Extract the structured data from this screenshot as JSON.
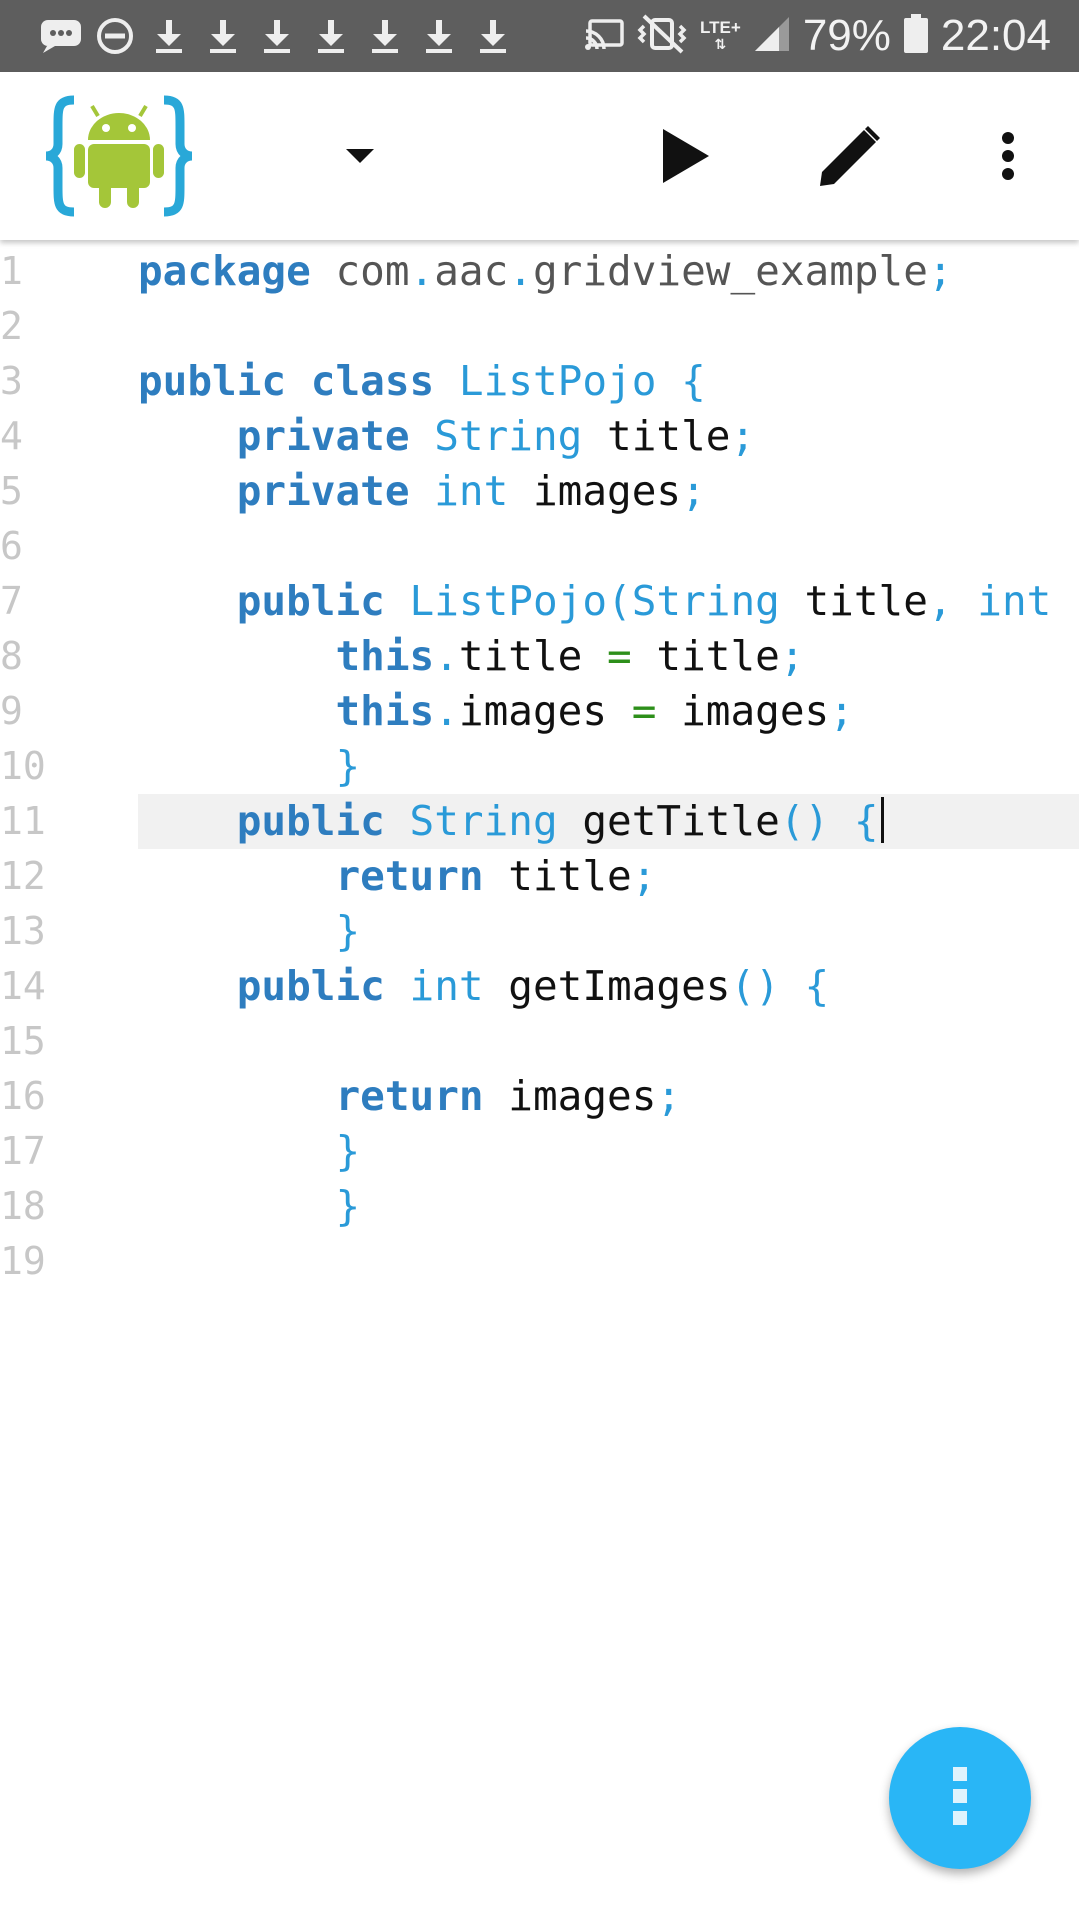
{
  "status_bar": {
    "left_icons": [
      "chat-bubble-icon",
      "do-not-disturb-icon",
      "download-icon",
      "download-icon",
      "download-icon",
      "download-icon",
      "download-icon",
      "download-icon",
      "download-icon"
    ],
    "network_label": "LTE+",
    "battery_percent": "79%",
    "time": "22:04"
  },
  "toolbar": {
    "app_icon": "android-braces-logo-icon",
    "dropdown_icon": "dropdown-arrow-icon",
    "run_icon": "play-icon",
    "edit_icon": "pencil-icon",
    "menu_icon": "more-vertical-icon"
  },
  "editor": {
    "current_line": 11,
    "lines": [
      {
        "n": "1",
        "tokens": [
          {
            "t": "package",
            "c": "kw"
          },
          {
            "t": " ",
            "c": "id"
          },
          {
            "t": "com",
            "c": "pk"
          },
          {
            "t": ".",
            "c": "pn"
          },
          {
            "t": "aac",
            "c": "pk"
          },
          {
            "t": ".",
            "c": "pn"
          },
          {
            "t": "gridview_example",
            "c": "pk"
          },
          {
            "t": ";",
            "c": "pn"
          }
        ]
      },
      {
        "n": "2",
        "tokens": []
      },
      {
        "n": "3",
        "tokens": [
          {
            "t": "public class",
            "c": "kw"
          },
          {
            "t": " ",
            "c": "id"
          },
          {
            "t": "ListPojo",
            "c": "ty"
          },
          {
            "t": " {",
            "c": "pn"
          }
        ]
      },
      {
        "n": "4",
        "tokens": [
          {
            "t": "    ",
            "c": "id"
          },
          {
            "t": "private",
            "c": "kw"
          },
          {
            "t": " ",
            "c": "id"
          },
          {
            "t": "String",
            "c": "ty"
          },
          {
            "t": " title",
            "c": "id"
          },
          {
            "t": ";",
            "c": "pn"
          }
        ]
      },
      {
        "n": "5",
        "tokens": [
          {
            "t": "    ",
            "c": "id"
          },
          {
            "t": "private",
            "c": "kw"
          },
          {
            "t": " ",
            "c": "id"
          },
          {
            "t": "int",
            "c": "ty"
          },
          {
            "t": " images",
            "c": "id"
          },
          {
            "t": ";",
            "c": "pn"
          }
        ]
      },
      {
        "n": "6",
        "tokens": []
      },
      {
        "n": "7",
        "tokens": [
          {
            "t": "    ",
            "c": "id"
          },
          {
            "t": "public",
            "c": "kw"
          },
          {
            "t": " ",
            "c": "id"
          },
          {
            "t": "ListPojo(String",
            "c": "ty"
          },
          {
            "t": " title",
            "c": "id"
          },
          {
            "t": ", ",
            "c": "pn"
          },
          {
            "t": "int",
            "c": "ty"
          }
        ]
      },
      {
        "n": "8",
        "tokens": [
          {
            "t": "        ",
            "c": "id"
          },
          {
            "t": "this",
            "c": "kw"
          },
          {
            "t": ".",
            "c": "pn"
          },
          {
            "t": "title ",
            "c": "id"
          },
          {
            "t": "=",
            "c": "op"
          },
          {
            "t": " title",
            "c": "id"
          },
          {
            "t": ";",
            "c": "pn"
          }
        ]
      },
      {
        "n": "9",
        "tokens": [
          {
            "t": "        ",
            "c": "id"
          },
          {
            "t": "this",
            "c": "kw"
          },
          {
            "t": ".",
            "c": "pn"
          },
          {
            "t": "images ",
            "c": "id"
          },
          {
            "t": "=",
            "c": "op"
          },
          {
            "t": " images",
            "c": "id"
          },
          {
            "t": ";",
            "c": "pn"
          }
        ]
      },
      {
        "n": "10",
        "tokens": [
          {
            "t": "        ",
            "c": "id"
          },
          {
            "t": "}",
            "c": "pn"
          }
        ]
      },
      {
        "n": "11",
        "tokens": [
          {
            "t": "    ",
            "c": "id"
          },
          {
            "t": "public",
            "c": "kw"
          },
          {
            "t": " ",
            "c": "id"
          },
          {
            "t": "String",
            "c": "ty"
          },
          {
            "t": " getTitle",
            "c": "id"
          },
          {
            "t": "() {",
            "c": "pn"
          }
        ],
        "caret": true
      },
      {
        "n": "12",
        "tokens": [
          {
            "t": "        ",
            "c": "id"
          },
          {
            "t": "return",
            "c": "kw"
          },
          {
            "t": " title",
            "c": "id"
          },
          {
            "t": ";",
            "c": "pn"
          }
        ]
      },
      {
        "n": "13",
        "tokens": [
          {
            "t": "        ",
            "c": "id"
          },
          {
            "t": "}",
            "c": "pn"
          }
        ]
      },
      {
        "n": "14",
        "tokens": [
          {
            "t": "    ",
            "c": "id"
          },
          {
            "t": "public",
            "c": "kw"
          },
          {
            "t": " ",
            "c": "id"
          },
          {
            "t": "int",
            "c": "ty"
          },
          {
            "t": " getImages",
            "c": "id"
          },
          {
            "t": "() {",
            "c": "pn"
          }
        ]
      },
      {
        "n": "15",
        "tokens": []
      },
      {
        "n": "16",
        "tokens": [
          {
            "t": "        ",
            "c": "id"
          },
          {
            "t": "return",
            "c": "kw"
          },
          {
            "t": " images",
            "c": "id"
          },
          {
            "t": ";",
            "c": "pn"
          }
        ]
      },
      {
        "n": "17",
        "tokens": [
          {
            "t": "        ",
            "c": "id"
          },
          {
            "t": "}",
            "c": "pn"
          }
        ]
      },
      {
        "n": "18",
        "tokens": [
          {
            "t": "        ",
            "c": "id"
          },
          {
            "t": "}",
            "c": "pn"
          }
        ]
      },
      {
        "n": "19",
        "tokens": []
      }
    ]
  },
  "fab": {
    "icon": "more-vertical-icon",
    "color": "#29b6f6"
  }
}
